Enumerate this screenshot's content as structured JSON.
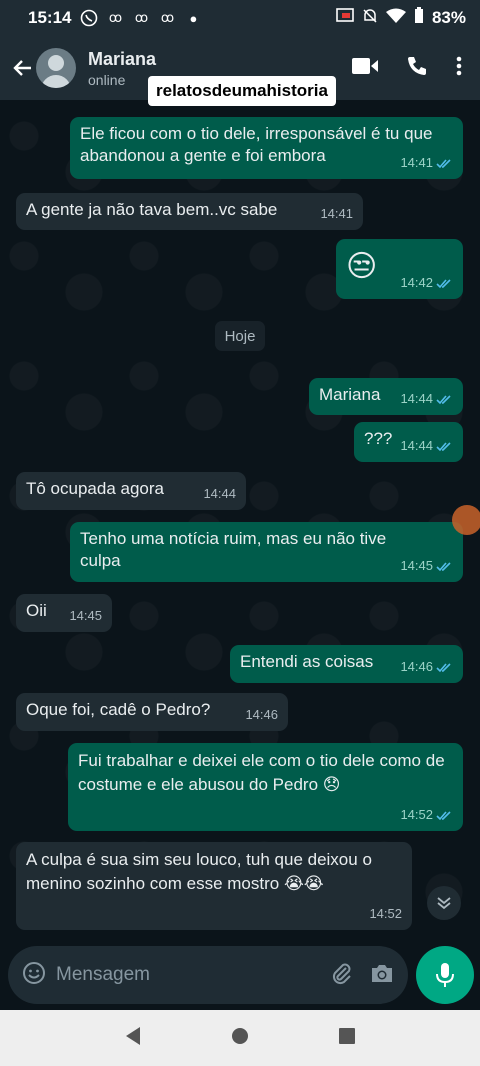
{
  "statusbar": {
    "time": "15:14",
    "battery": "83%"
  },
  "header": {
    "name": "Mariana",
    "status": "online"
  },
  "watermark": "relatosdeumahistoria",
  "day_separator": "Hoje",
  "messages": [
    {
      "dir": "out",
      "text": "Ele ficou com o tio dele, irresponsável é tu que abandonou a gente e foi embora",
      "time": "14:41"
    },
    {
      "dir": "in",
      "text": "A gente ja não tava bem..vc sabe",
      "time": "14:41"
    },
    {
      "dir": "out",
      "text": "😒",
      "time": "14:42"
    },
    {
      "dir": "out",
      "text": "Mariana",
      "time": "14:44"
    },
    {
      "dir": "out",
      "text": "???",
      "time": "14:44"
    },
    {
      "dir": "in",
      "text": "Tô ocupada agora",
      "time": "14:44"
    },
    {
      "dir": "out",
      "text": "Tenho uma notícia ruim, mas eu não tive culpa",
      "time": "14:45"
    },
    {
      "dir": "in",
      "text": "Oii",
      "time": "14:45"
    },
    {
      "dir": "out",
      "text": "Entendi as coisas",
      "time": "14:46"
    },
    {
      "dir": "in",
      "text": "Oque foi, cadê o Pedro?",
      "time": "14:46"
    },
    {
      "dir": "out",
      "text": "Fui trabalhar e deixei ele com o tio dele como de costume e ele abusou do Pedro 😞",
      "time": "14:52"
    },
    {
      "dir": "in",
      "text": "A culpa é sua sim seu louco, tuh que deixou o menino sozinho com esse mostro 😭😭",
      "time": "14:52"
    }
  ],
  "composer": {
    "placeholder": "Mensagem"
  },
  "colors": {
    "outgoing": "#005c4b",
    "incoming": "#202c33",
    "accent": "#00a884",
    "read_tick": "#53bdeb"
  }
}
